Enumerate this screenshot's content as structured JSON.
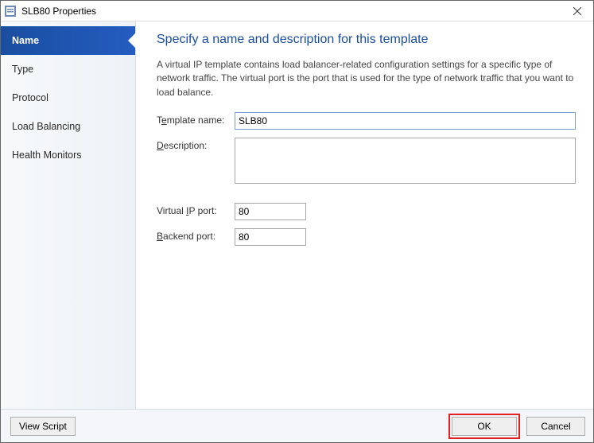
{
  "window": {
    "title": "SLB80 Properties"
  },
  "sidebar": {
    "items": [
      {
        "label": "Name",
        "active": true
      },
      {
        "label": "Type",
        "active": false
      },
      {
        "label": "Protocol",
        "active": false
      },
      {
        "label": "Load Balancing",
        "active": false
      },
      {
        "label": "Health Monitors",
        "active": false
      }
    ]
  },
  "content": {
    "heading": "Specify a name and description for this template",
    "intro": "A virtual IP template contains load balancer-related configuration settings for a specific type of network traffic. The virtual port is the port that is used for the type of network traffic that you want to load balance.",
    "labels": {
      "template_name_pre": "T",
      "template_name_accel": "e",
      "template_name_post": "mplate name:",
      "description_accel": "D",
      "description_post": "escription:",
      "vip_pre": "Virtual ",
      "vip_accel": "I",
      "vip_post": "P port:",
      "backend_accel": "B",
      "backend_post": "ackend port:"
    },
    "values": {
      "template_name": "SLB80",
      "description": "",
      "virtual_ip_port": "80",
      "backend_port": "80"
    }
  },
  "footer": {
    "view_script": "View Script",
    "ok": "OK",
    "cancel": "Cancel"
  }
}
